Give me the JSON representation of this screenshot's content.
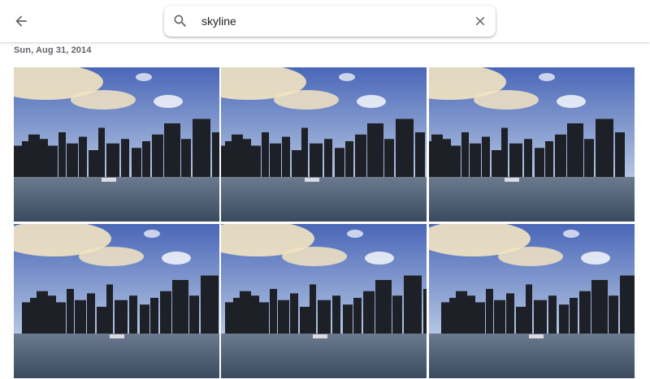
{
  "header": {
    "back_icon": "arrow-back-icon",
    "search": {
      "icon": "search-icon",
      "value": "skyline",
      "clear_icon": "close-icon"
    }
  },
  "section": {
    "date": "Sun, Aug 31, 2014"
  },
  "photos": [
    {
      "alt": "Chicago skyline over water 1"
    },
    {
      "alt": "Chicago skyline over water 2"
    },
    {
      "alt": "Chicago skyline over water 3"
    },
    {
      "alt": "Chicago skyline over water 4"
    },
    {
      "alt": "Chicago skyline over water 5"
    },
    {
      "alt": "Chicago skyline over water 6"
    }
  ],
  "colors": {
    "sky_top": "#4a67b8",
    "sky_bottom": "#b8c9e3",
    "cloud": "#f3e4c2",
    "water": "#3b4a5e",
    "buildings": "#1d2026"
  }
}
